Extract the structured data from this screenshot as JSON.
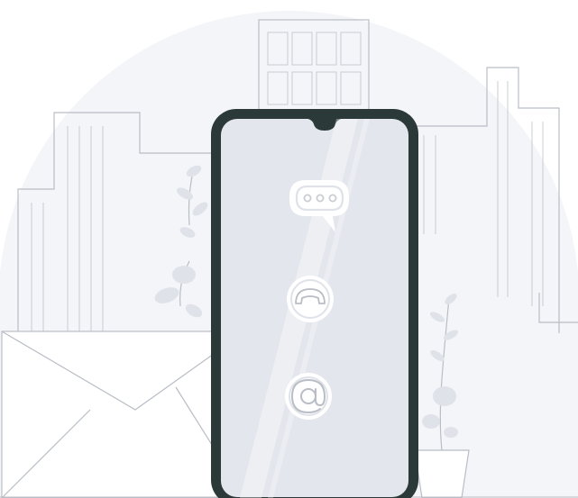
{
  "illustration": {
    "icons": [
      {
        "name": "chat-bubble-icon"
      },
      {
        "name": "phone-handset-icon"
      },
      {
        "name": "at-sign-icon"
      }
    ],
    "colors": {
      "background_circle": "#f3f5f8",
      "phone_body": "#2b3a38",
      "phone_screen": "#e3e6ec",
      "icon_fill": "#ffffff",
      "line_art": "#b9bdc5",
      "leaf": "#dfe3e9"
    }
  }
}
